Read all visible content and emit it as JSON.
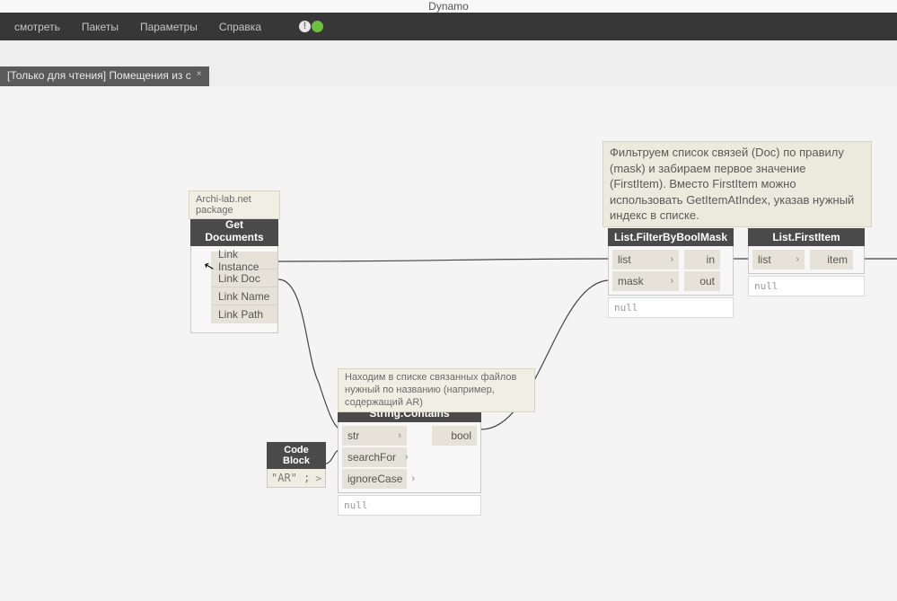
{
  "app": {
    "title": "Dynamo"
  },
  "menu": {
    "items": [
      "смотреть",
      "Пакеты",
      "Параметры",
      "Справка"
    ]
  },
  "tab": {
    "label": "[Только для чтения] Помещения из с",
    "close_glyph": "×"
  },
  "notes": {
    "getdocs": "Archi-lab.net package",
    "contains": "Находим в списке связанных файлов нужный по названию (например, содержащий AR)",
    "filter": "Фильтруем список связей (Doc) по правилу (mask) и забираем первое значение (FirstItem). Вместо FirstItem можно использовать GetItemAtIndex, указав нужный индекс в списке."
  },
  "nodes": {
    "getDocuments": {
      "title": "Get Documents",
      "outputs": [
        "Link Instance",
        "Link Doc",
        "Link Name",
        "Link Path"
      ]
    },
    "codeBlock": {
      "title": "Code Block",
      "code": "\"AR\" ;",
      "outmark": ">"
    },
    "stringContains": {
      "title": "String.Contains",
      "inputs": [
        "str",
        "searchFor",
        "ignoreCase"
      ],
      "outputs": [
        "bool"
      ],
      "preview": "null"
    },
    "filterByBoolMask": {
      "title": "List.FilterByBoolMask",
      "inputs": [
        "list",
        "mask"
      ],
      "outputs": [
        "in",
        "out"
      ],
      "preview": "null"
    },
    "firstItem": {
      "title": "List.FirstItem",
      "inputs": [
        "list"
      ],
      "outputs": [
        "item"
      ],
      "preview": "null"
    }
  },
  "chev": "›"
}
